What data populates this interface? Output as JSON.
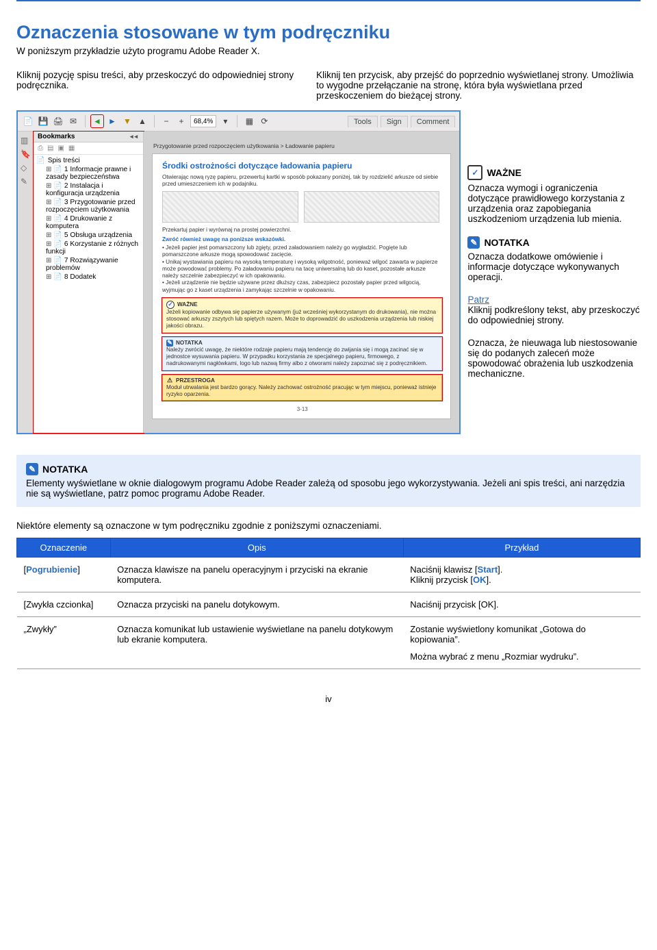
{
  "title": "Oznaczenia stosowane w tym podręczniku",
  "subtitle": "W poniższym przykładzie użyto programu Adobe Reader X.",
  "intro": {
    "left": "Kliknij pozycję spisu treści, aby przeskoczyć do odpowiedniej strony podręcznika.",
    "right": "Kliknij ten przycisk, aby przejść do poprzednio wyświetlanej strony. Umożliwia to wygodne przełączanie na stronę, która była wyświetlana przed przeskoczeniem do bieżącej strony."
  },
  "reader": {
    "toolbar": {
      "zoom": "68,4%",
      "tools": "Tools",
      "sign": "Sign",
      "comment": "Comment"
    },
    "bookmarks": {
      "header": "Bookmarks",
      "root": "Spis treści",
      "items": [
        "1 Informacje prawne i zasady bezpieczeństwa",
        "2 Instalacja i konfiguracja urządzenia",
        "3 Przygotowanie przed rozpoczęciem użytkowania",
        "4 Drukowanie z komputera",
        "5 Obsługa urządzenia",
        "6 Korzystanie z różnych funkcji",
        "7 Rozwiązywanie problemów",
        "8 Dodatek"
      ]
    },
    "doc": {
      "breadcrumb": "Przygotowanie przed rozpoczęciem użytkowania > Ładowanie papieru",
      "heading": "Środki ostrożności dotyczące ładowania papieru",
      "intro": "Otwierając nową ryzę papieru, przewertuj kartki w sposób pokazany poniżej, tak by rozdzielić arkusze od siebie przed umieszczeniem ich w podajniku.",
      "line1": "Przekartuj papier i wyrównaj na prostej powierzchni.",
      "line2": "Zwróć również uwagę na poniższe wskazówki.",
      "b1": "Jeżeli papier jest pomarszczony lub zgięty, przed załadowaniem należy go wygładzić. Pogięte lub pomarszczone arkusze mogą spowodować zacięcie.",
      "b2": "Unikaj wystawiania papieru na wysoką temperaturę i wysoką wilgotność, ponieważ wilgoć zawarta w papierze może powodować problemy. Po załadowaniu papieru na tacę uniwersalną lub do kaset, pozostałe arkusze należy szczelnie zabezpieczyć w ich opakowaniu.",
      "b3": "Jeżeli urządzenie nie będzie używane przez dłuższy czas, zabezpiecz pozostały papier przed wilgocią, wyjmując go z kaset urządzenia i zamykając szczelnie w opakowaniu.",
      "wazne_label": "WAŻNE",
      "wazne_body": "Jeżeli kopiowanie odbywa się papierze używanym (już wcześniej wykorzystanym do drukowania), nie można stosować arkuszy zszytych lub spiętych razem. Może to doprowadzić do uszkodzenia urządzenia lub niskiej jakości obrazu.",
      "notatka_label": "NOTATKA",
      "notatka_body": "Należy zwrócić uwagę, że niektóre rodzaje papieru mają tendencję do zwijania się i mogą zacinać się w jednostce wysuwania papieru. W przypadku korzystania ze specjalnego papieru, firmowego, z nadrukowanymi nagłówkami, logo lub nazwą firmy albo z otworami należy zapoznać się z podręcznikiem.",
      "przestroga_label": "PRZESTROGA",
      "przestroga_body": "Moduł utrwalania jest bardzo gorący. Należy zachować ostrożność pracując w tym miejscu, ponieważ istnieje ryzyko oparzenia.",
      "footer": "3-13"
    }
  },
  "callouts": {
    "wazne": {
      "label": "WAŻNE",
      "body": "Oznacza wymogi i ograniczenia dotyczące prawidłowego korzystania z urządzenia oraz zapobiegania uszkodzeniom urządzenia lub mienia."
    },
    "notatka": {
      "label": "NOTATKA",
      "body": "Oznacza dodatkowe omówienie i informacje dotyczące wykonywanych operacji."
    },
    "patrz": {
      "label": "Patrz",
      "body": "Kliknij podkreślony tekst, aby przeskoczyć do odpowiedniej strony."
    },
    "caution": {
      "body": "Oznacza, że nieuwaga lub niestosowanie się do podanych zaleceń może spowodować obrażenia lub uszkodzenia mechaniczne."
    }
  },
  "big_note": {
    "label": "NOTATKA",
    "body": "Elementy wyświetlane w oknie dialogowym programu Adobe Reader zależą od sposobu jego wykorzystywania. Jeżeli ani spis treści, ani narzędzia nie są wyświetlane, patrz pomoc programu Adobe Reader."
  },
  "conventions_intro": "Niektóre elementy są oznaczone w tym podręczniku zgodnie z poniższymi oznaczeniami.",
  "table": {
    "headers": {
      "c1": "Oznaczenie",
      "c2": "Opis",
      "c3": "Przykład"
    },
    "rows": [
      {
        "c1_open": "[",
        "c1_mid": "Pogrubienie",
        "c1_close": "]",
        "c2": "Oznacza klawisze na panelu operacyjnym i przyciski na ekranie komputera.",
        "c3a_pre": "Naciśnij klawisz [",
        "c3a_mid": "Start",
        "c3a_post": "].",
        "c3b_pre": "Kliknij przycisk [",
        "c3b_mid": "OK",
        "c3b_post": "]."
      },
      {
        "c1": "[Zwykła czcionka]",
        "c2": "Oznacza przyciski na panelu dotykowym.",
        "c3": "Naciśnij przycisk [OK]."
      },
      {
        "c1": "„Zwykły”",
        "c2": "Oznacza komunikat lub ustawienie wyświetlane na panelu dotykowym lub ekranie komputera.",
        "c3a": "Zostanie wyświetlony komunikat „Gotowa do kopiowania”.",
        "c3b": "Można wybrać z menu „Rozmiar wydruku”."
      }
    ]
  },
  "page_number": "iv"
}
